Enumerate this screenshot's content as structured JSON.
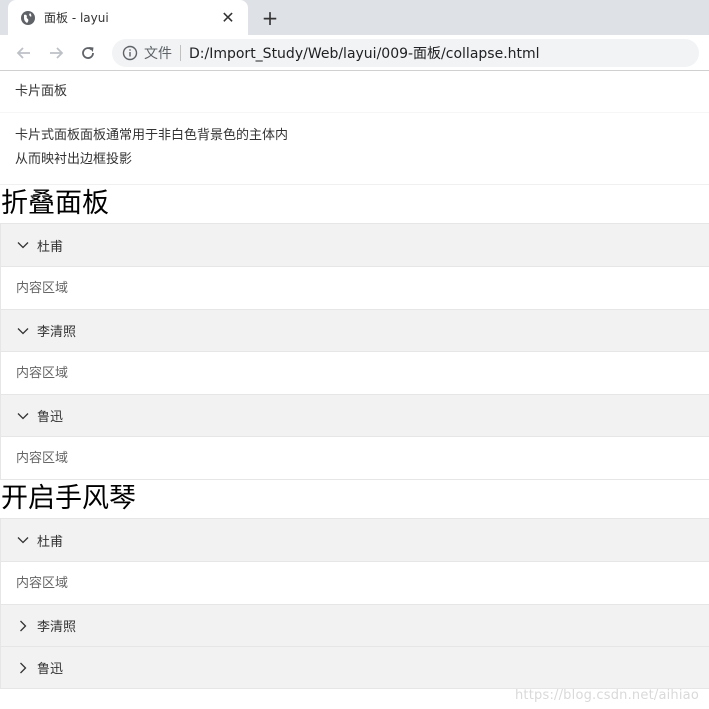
{
  "browser": {
    "tab_title": "面板 - layui",
    "close_glyph": "✕",
    "new_tab_glyph": "+",
    "scheme_label": "文件",
    "url": "D:/Import_Study/Web/layui/009-面板/collapse.html"
  },
  "card": {
    "header": "卡片面板",
    "body_line1": "卡片式面板面板通常用于非白色背景色的主体内",
    "body_line2": "从而映衬出边框投影"
  },
  "collapse": {
    "title": "折叠面板",
    "items": [
      {
        "title": "杜甫",
        "content": "内容区域",
        "expanded": true
      },
      {
        "title": "李清照",
        "content": "内容区域",
        "expanded": true
      },
      {
        "title": "鲁迅",
        "content": "内容区域",
        "expanded": true
      }
    ]
  },
  "accordion": {
    "title": "开启手风琴",
    "items": [
      {
        "title": "杜甫",
        "content": "内容区域",
        "expanded": true
      },
      {
        "title": "李清照",
        "expanded": false
      },
      {
        "title": "鲁迅",
        "expanded": false
      }
    ]
  },
  "watermark": "https://blog.csdn.net/aihiao"
}
